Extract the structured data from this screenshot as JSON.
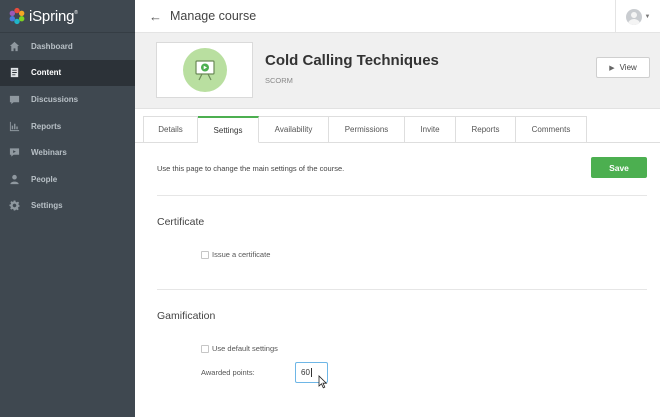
{
  "brand": {
    "name": "iSpring",
    "mark": "®"
  },
  "sidebar": {
    "items": [
      {
        "label": "Dashboard",
        "icon": "home-icon",
        "active": false
      },
      {
        "label": "Content",
        "icon": "content-icon",
        "active": true
      },
      {
        "label": "Discussions",
        "icon": "discussions-icon",
        "active": false
      },
      {
        "label": "Reports",
        "icon": "reports-icon",
        "active": false
      },
      {
        "label": "Webinars",
        "icon": "webinars-icon",
        "active": false
      },
      {
        "label": "People",
        "icon": "people-icon",
        "active": false
      },
      {
        "label": "Settings",
        "icon": "gear-icon",
        "active": false
      }
    ]
  },
  "topbar": {
    "back_icon": "←",
    "title": "Manage course"
  },
  "course": {
    "title": "Cold Calling Techniques",
    "type": "SCORM",
    "view_label": "View",
    "view_icon": "▶"
  },
  "tabs": [
    {
      "label": "Details",
      "active": false
    },
    {
      "label": "Settings",
      "active": true
    },
    {
      "label": "Availability",
      "active": false
    },
    {
      "label": "Permissions",
      "active": false
    },
    {
      "label": "Invite",
      "active": false
    },
    {
      "label": "Reports",
      "active": false
    },
    {
      "label": "Comments",
      "active": false
    }
  ],
  "settings": {
    "intro": "Use this page to change the main settings of the course.",
    "save_label": "Save",
    "certificate": {
      "title": "Certificate",
      "issue_label": "Issue a certificate",
      "issue_checked": false
    },
    "gamification": {
      "title": "Gamification",
      "default_label": "Use default settings",
      "default_checked": false,
      "points_label": "Awarded points:",
      "points_value": "60"
    }
  },
  "colors": {
    "sidebar_bg": "#3f4850",
    "sidebar_active": "#2c3238",
    "accent_green": "#4caf50",
    "input_focus": "#6eb6e6"
  }
}
